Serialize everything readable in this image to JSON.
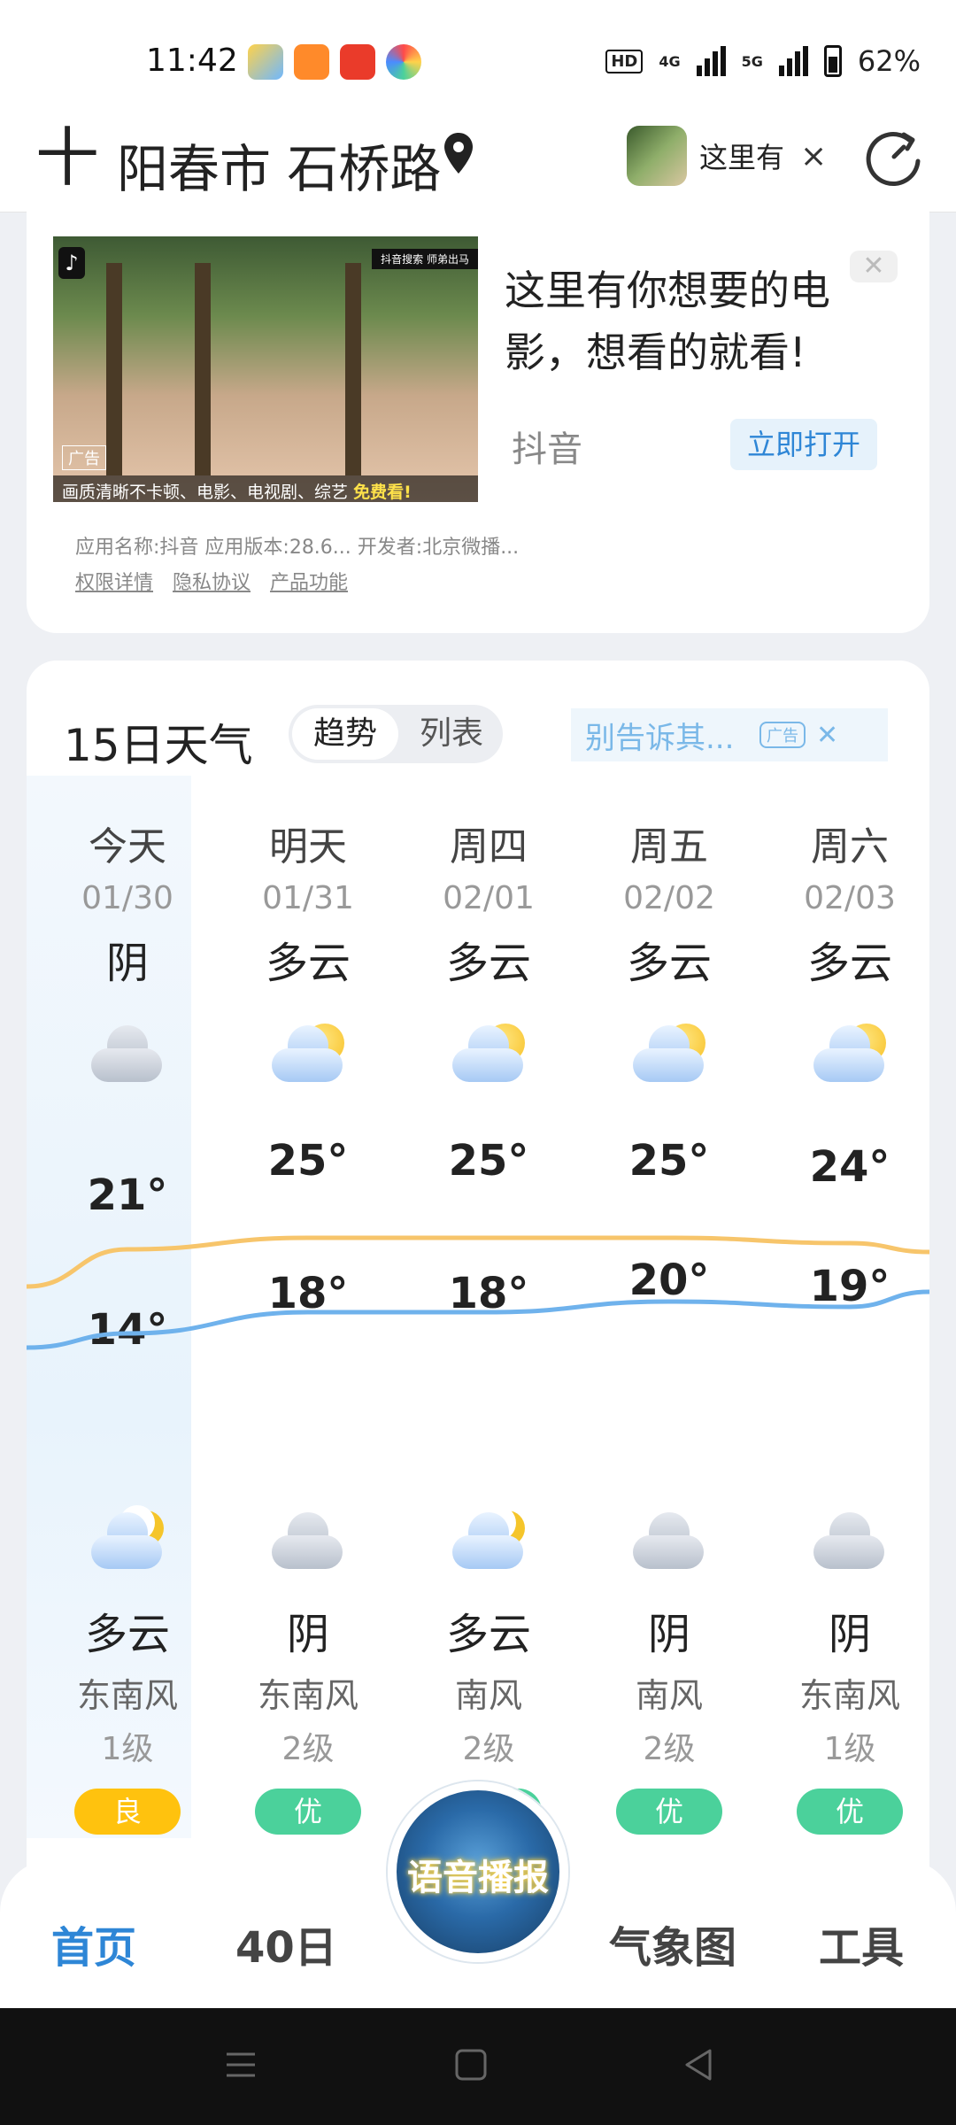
{
  "status": {
    "time": "11:42",
    "hd": "HD",
    "net1": "4G",
    "net2": "5G",
    "battery": "62%"
  },
  "header": {
    "plus": "十",
    "location": "阳春市 石桥路",
    "ad_text": "这里有",
    "ad_close": "×"
  },
  "ad_card": {
    "title": "这里有你想要的电影，想看的就看!",
    "brand": "抖音",
    "open_button": "立即打开",
    "close": "✕",
    "image_caption_prefix": "画质清晰不卡顿、电影、电视剧、综艺",
    "image_caption_highlight": "免费看!",
    "image_tag": "广告",
    "image_top_right": "抖音搜索   师弟出马",
    "meta": "应用名称:抖音    应用版本:28.6...    开发者:北京微播...",
    "links": [
      "权限详情",
      "隐私协议",
      "产品功能"
    ]
  },
  "weather": {
    "title": "15日天气",
    "toggle_on": "趋势",
    "toggle_off": "列表",
    "ad_text": "别告诉其...",
    "ad_badge": "广告",
    "ad_close": "✕",
    "days": [
      {
        "day": "今天",
        "date": "01/30",
        "cond": "阴",
        "icon": "overcast-cloud-icon",
        "hi": "21°",
        "lo": "14°",
        "night_icon": "partly-cloudy-night-icon",
        "night_cond": "多云",
        "wind": "东南风",
        "level": "1级",
        "aqi": "良",
        "aqi_color": "#ffc20e"
      },
      {
        "day": "明天",
        "date": "01/31",
        "cond": "多云",
        "icon": "partly-cloudy-day-icon",
        "hi": "25°",
        "lo": "18°",
        "night_icon": "overcast-cloud-icon",
        "night_cond": "阴",
        "wind": "东南风",
        "level": "2级",
        "aqi": "优",
        "aqi_color": "#4bd19b"
      },
      {
        "day": "周四",
        "date": "02/01",
        "cond": "多云",
        "icon": "partly-cloudy-day-icon",
        "hi": "25°",
        "lo": "18°",
        "night_icon": "partly-cloudy-night-icon",
        "night_cond": "多云",
        "wind": "南风",
        "level": "2级",
        "aqi": "优",
        "aqi_color": "#4bd19b"
      },
      {
        "day": "周五",
        "date": "02/02",
        "cond": "多云",
        "icon": "partly-cloudy-day-icon",
        "hi": "25°",
        "lo": "20°",
        "night_icon": "overcast-cloud-icon",
        "night_cond": "阴",
        "wind": "南风",
        "level": "2级",
        "aqi": "优",
        "aqi_color": "#4bd19b"
      },
      {
        "day": "周六",
        "date": "02/03",
        "cond": "多云",
        "icon": "partly-cloudy-day-icon",
        "hi": "24°",
        "lo": "19°",
        "night_icon": "overcast-cloud-icon",
        "night_cond": "阴",
        "wind": "东南风",
        "level": "1级",
        "aqi": "优",
        "aqi_color": "#4bd19b"
      }
    ]
  },
  "bottom_nav": {
    "home": "首页",
    "forty_day": "40日",
    "voice": "语音播报",
    "weather_map": "气象图",
    "tools": "工具"
  },
  "colors": {
    "accent": "#2e86d6",
    "high_line": "#f7c56b",
    "low_line": "#6fb2ec"
  }
}
